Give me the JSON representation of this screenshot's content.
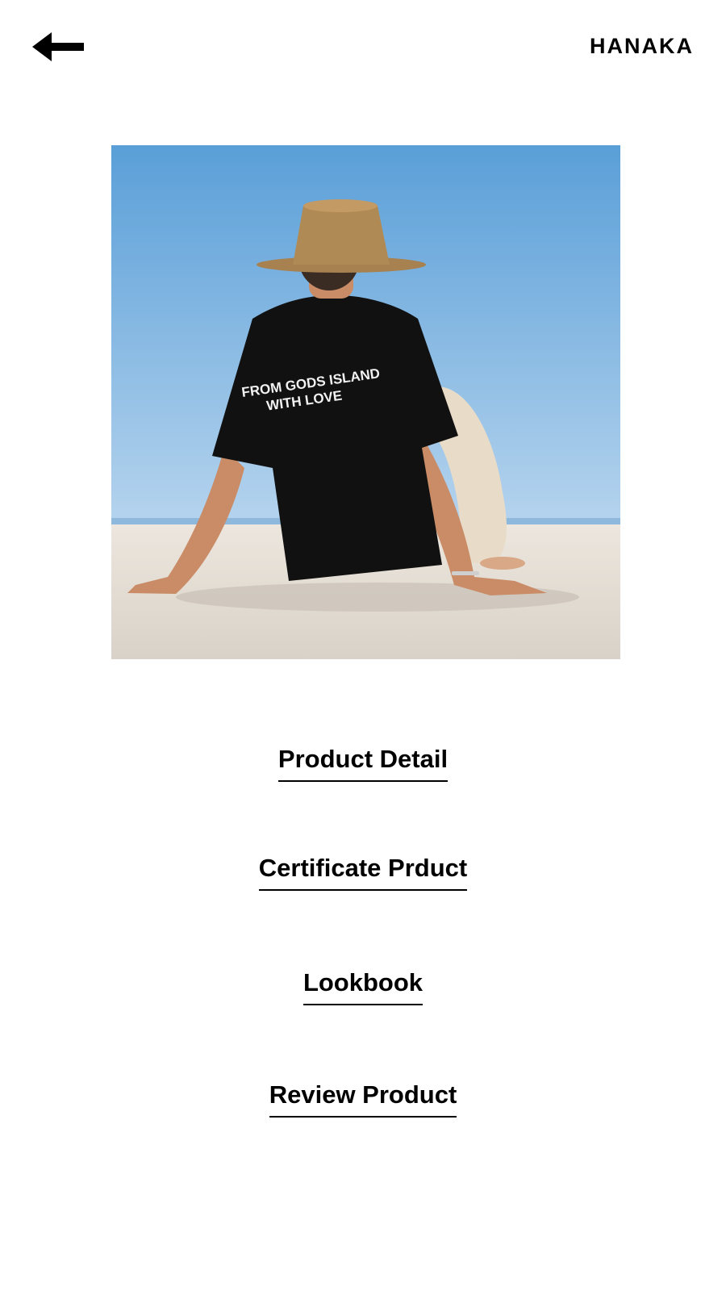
{
  "header": {
    "back_icon": "arrow-left-icon",
    "brand": "HANAKA"
  },
  "hero": {
    "shirt_print_line1": "FROM GODS ISLAND",
    "shirt_print_line2": "WITH LOVE",
    "colors": {
      "sky_top": "#5a9fd8",
      "sky_bottom": "#b6d4ee",
      "sand": "#e6ded4",
      "shirt": "#111111",
      "hat": "#b08a55"
    }
  },
  "menu": {
    "product_detail": "Product Detail",
    "certificate_product": "Certificate Prduct",
    "lookbook": "Lookbook",
    "review_product": "Review Product"
  }
}
